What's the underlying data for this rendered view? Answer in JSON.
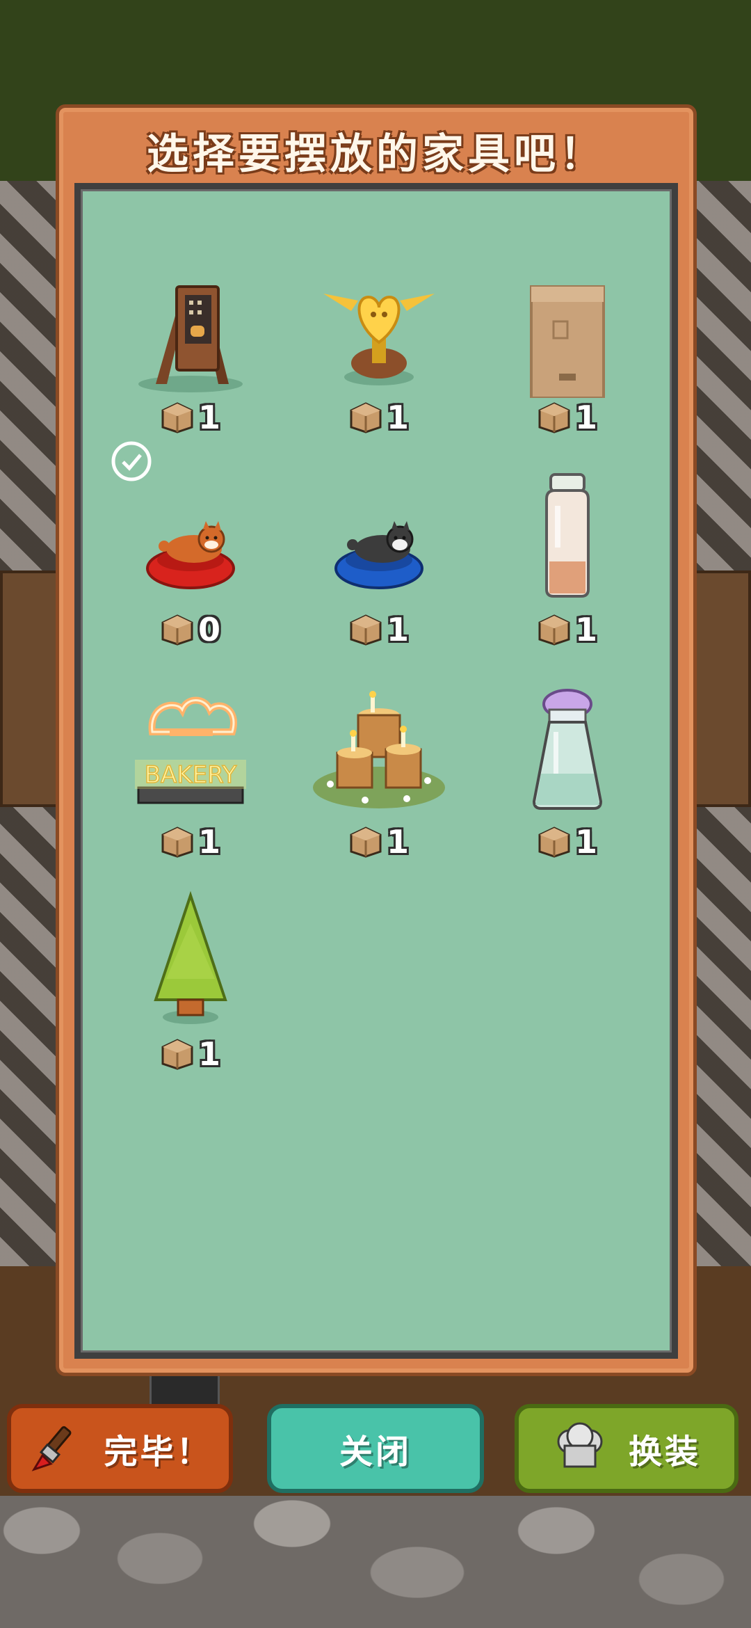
{
  "dialog": {
    "title": "选择要摆放的家具吧！"
  },
  "furniture": [
    {
      "name": "easel-sign",
      "count": "1",
      "selected": false
    },
    {
      "name": "golden-heart-trophy",
      "count": "1",
      "selected": false
    },
    {
      "name": "cardboard-box",
      "count": "1",
      "selected": false
    },
    {
      "name": "shiba-dog-bed",
      "count": "0",
      "selected": true
    },
    {
      "name": "husky-dog-bed",
      "count": "1",
      "selected": false
    },
    {
      "name": "milk-bottle",
      "count": "1",
      "selected": false
    },
    {
      "name": "bakery-neon-sign",
      "count": "1",
      "selected": false,
      "sign_text": "BAKERY"
    },
    {
      "name": "candle-stumps",
      "count": "1",
      "selected": false
    },
    {
      "name": "glass-jar",
      "count": "1",
      "selected": false
    },
    {
      "name": "pine-tree",
      "count": "1",
      "selected": false
    }
  ],
  "buttons": {
    "done_label": "完毕！",
    "close_label": "关闭",
    "outfit_label": "换装"
  },
  "colors": {
    "panel_bg": "#8ec5a7",
    "frame": "#d9824f",
    "done": "#c9541c",
    "close": "#49c3a9",
    "outfit": "#7ea629"
  }
}
